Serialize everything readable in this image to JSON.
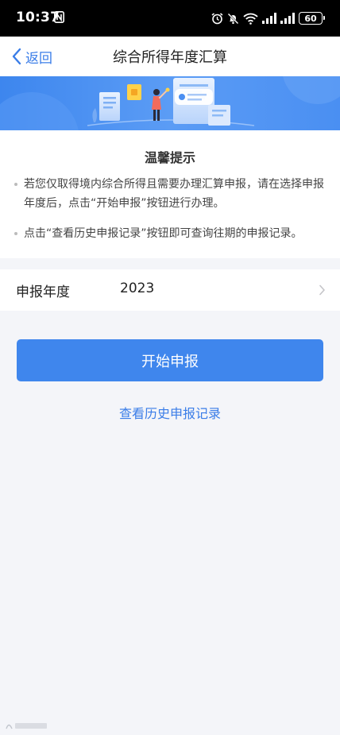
{
  "status_bar": {
    "time": "10:37",
    "battery": "60"
  },
  "nav": {
    "back_label": "返回",
    "title": "综合所得年度汇算"
  },
  "tips": {
    "title": "温馨提示",
    "items": [
      "若您仅取得境内综合所得且需要办理汇算申报，请在选择申报年度后，点击“开始申报”按钮进行办理。",
      "点击“查看历史申报记录”按钮即可查询往期的申报记录。"
    ]
  },
  "year_row": {
    "label": "申报年度",
    "value": "2023"
  },
  "actions": {
    "start_label": "开始申报",
    "history_label": "查看历史申报记录"
  },
  "colors": {
    "accent": "#3f86ed",
    "link": "#3a7de8",
    "page_bg": "#f4f5f9"
  }
}
